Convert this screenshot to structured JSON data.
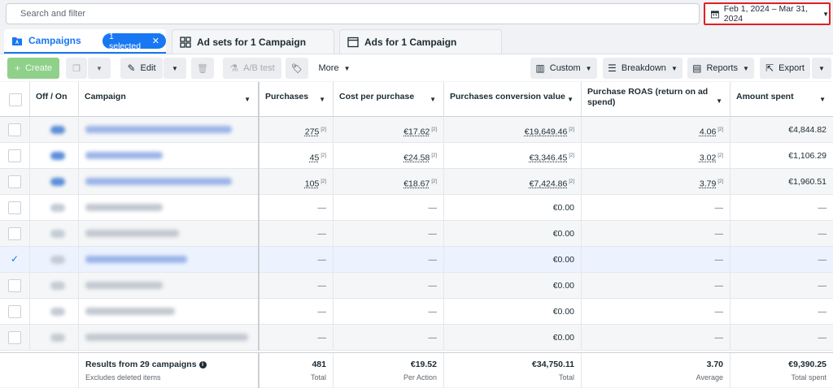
{
  "search": {
    "placeholder": "Search and filter"
  },
  "date_range": "Feb 1, 2024 – Mar 31, 2024",
  "tabs": {
    "campaigns": "Campaigns",
    "selected": "1 selected",
    "adsets": "Ad sets for 1 Campaign",
    "ads": "Ads for 1 Campaign"
  },
  "toolbar": {
    "create": "Create",
    "edit": "Edit",
    "ab_test": "A/B test",
    "more": "More",
    "custom": "Custom",
    "breakdown": "Breakdown",
    "reports": "Reports",
    "export": "Export"
  },
  "columns": {
    "toggle": "Off / On",
    "campaign": "Campaign",
    "purchases": "Purchases",
    "cost_per_purchase": "Cost per purchase",
    "conversion_value": "Purchases conversion value",
    "roas": "Purchase ROAS (return on ad spend)",
    "amount_spent": "Amount spent"
  },
  "rows": [
    {
      "purchases": "275",
      "cpp": "€17.62",
      "pcv": "€19,649.46",
      "roas": "4.06",
      "amount": "€4,844.82",
      "sup": "[2]"
    },
    {
      "purchases": "45",
      "cpp": "€24.58",
      "pcv": "€3,346.45",
      "roas": "3.02",
      "amount": "€1,106.29",
      "sup": "[2]"
    },
    {
      "purchases": "105",
      "cpp": "€18.67",
      "pcv": "€7,424.86",
      "roas": "3.79",
      "amount": "€1,960.51",
      "sup": "[2]"
    },
    {
      "purchases": "—",
      "cpp": "—",
      "pcv": "€0.00",
      "roas": "—",
      "amount": "—"
    },
    {
      "purchases": "—",
      "cpp": "—",
      "pcv": "€0.00",
      "roas": "—",
      "amount": "—"
    },
    {
      "purchases": "—",
      "cpp": "—",
      "pcv": "€0.00",
      "roas": "—",
      "amount": "—"
    },
    {
      "purchases": "—",
      "cpp": "—",
      "pcv": "€0.00",
      "roas": "—",
      "amount": "—"
    },
    {
      "purchases": "—",
      "cpp": "—",
      "pcv": "€0.00",
      "roas": "—",
      "amount": "—"
    },
    {
      "purchases": "—",
      "cpp": "—",
      "pcv": "€0.00",
      "roas": "—",
      "amount": "—"
    }
  ],
  "footer": {
    "title": "Results from 29 campaigns",
    "subtitle": "Excludes deleted items",
    "purchases": "481",
    "purchases_sub": "Total",
    "cpp": "€19.52",
    "cpp_sub": "Per Action",
    "pcv": "€34,750.11",
    "pcv_sub": "Total",
    "roas": "3.70",
    "roas_sub": "Average",
    "amount": "€9,390.25",
    "amount_sub": "Total spent"
  },
  "colors": {
    "accent": "#1877f2",
    "highlight": "#e41e26",
    "create": "#8fd18b"
  }
}
